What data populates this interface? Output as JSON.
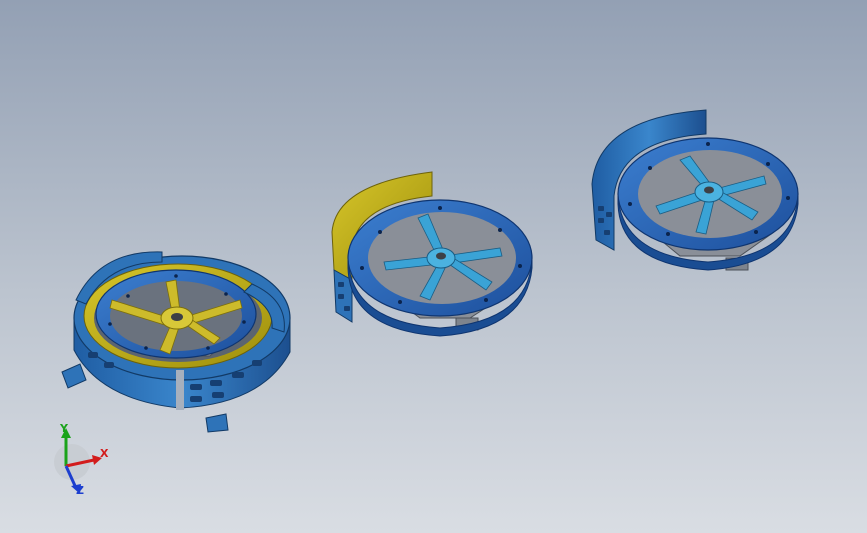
{
  "viewport": {
    "background_top": "#93a0b4",
    "background_bottom": "#d9dde3"
  },
  "colors": {
    "ring_blue": "#2f6fc0",
    "ring_blue_dark": "#184f99",
    "spoke_yellow": "#c9b52b",
    "shroud_yellow": "#c6b813",
    "spoke_cyan": "#3aa3d6",
    "frame_gray": "#8a8f98",
    "housing_blue": "#2e73b8"
  },
  "triad": {
    "y_label": "Y",
    "x_label": "X",
    "z_label": "Z",
    "y_color": "#1aa31a",
    "x_color": "#d21c1c",
    "z_color": "#1d3fcf"
  }
}
